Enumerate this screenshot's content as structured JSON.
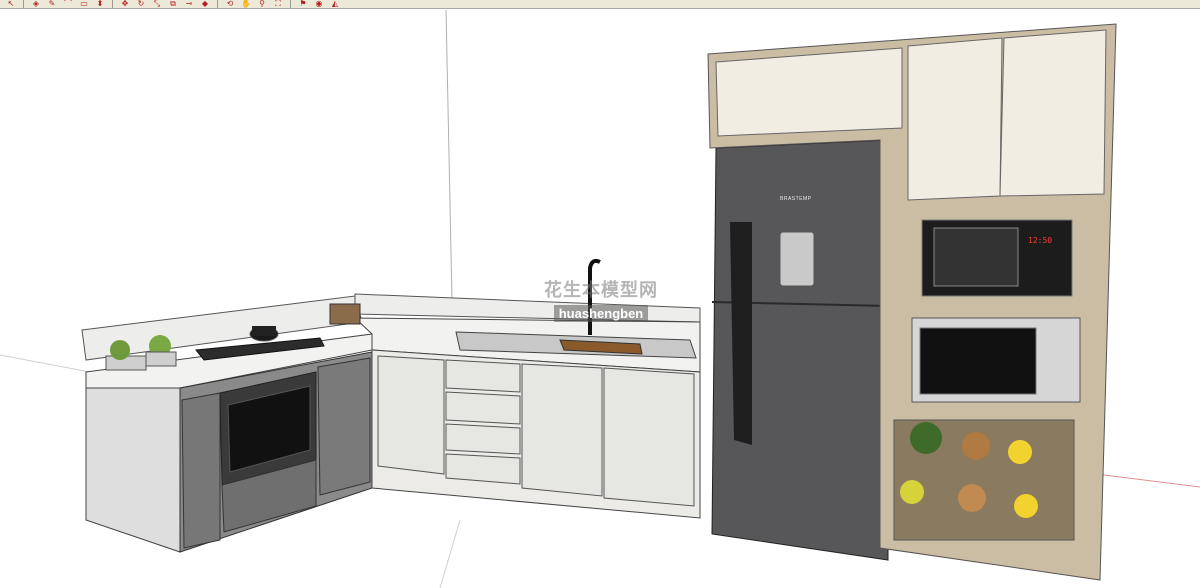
{
  "toolbar": {
    "tools": [
      {
        "name": "select-arrow-icon",
        "glyph": "↖"
      },
      {
        "name": "eraser-icon",
        "glyph": "◈"
      },
      {
        "name": "pencil-icon",
        "glyph": "✎"
      },
      {
        "name": "arc-icon",
        "glyph": "⌒"
      },
      {
        "name": "rectangle-icon",
        "glyph": "▭"
      },
      {
        "name": "push-pull-icon",
        "glyph": "⬍"
      },
      {
        "name": "move-icon",
        "glyph": "✥"
      },
      {
        "name": "rotate-icon",
        "glyph": "↻"
      },
      {
        "name": "scale-icon",
        "glyph": "⤡"
      },
      {
        "name": "offset-icon",
        "glyph": "⧉"
      },
      {
        "name": "tape-measure-icon",
        "glyph": "⊸"
      },
      {
        "name": "paint-bucket-icon",
        "glyph": "◆"
      },
      {
        "name": "orbit-icon",
        "glyph": "⟲"
      },
      {
        "name": "pan-icon",
        "glyph": "✋"
      },
      {
        "name": "zoom-icon",
        "glyph": "⚲"
      },
      {
        "name": "zoom-extents-icon",
        "glyph": "⛶"
      },
      {
        "name": "walk-icon",
        "glyph": "⚑"
      },
      {
        "name": "look-around-icon",
        "glyph": "◉"
      },
      {
        "name": "section-plane-icon",
        "glyph": "◭"
      }
    ]
  },
  "scene": {
    "watermark_cn": "花生本模型网",
    "watermark_en": "huashengben",
    "fridge_brand": "BRASTEMP",
    "microwave_clock": "12:50"
  },
  "colors": {
    "cabinet_white": "#e9e9e6",
    "cabinet_gray": "#6b6b6b",
    "countertop": "#f2f2f0",
    "fridge": "#57575a",
    "wood_frame": "#cbbda4",
    "upper_door": "#f1ede2",
    "appliance_black": "#1c1c1c",
    "axis_red": "#d89090"
  }
}
